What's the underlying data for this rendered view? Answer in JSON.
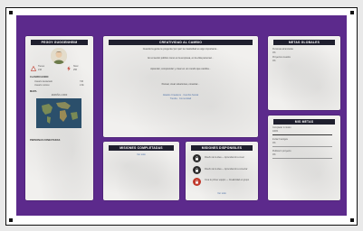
{
  "profile": {
    "title": "PEGGY GUGGENHEIM",
    "stat_left_label": "Tienes",
    "stat_left_value": "216",
    "stat_right_label": "Nivel",
    "stat_right_value": "256",
    "section_classification": "CLASIFICACION",
    "class_rows": [
      {
        "label": "Usuario destacado",
        "value": "746"
      },
      {
        "label": "Usuario curioso",
        "value": "2.9k"
      }
    ],
    "section_map": "MAPA",
    "map_label": "ESPAÑA 1.0000",
    "connected_label": "PERSONAS CONECTADAS"
  },
  "center": {
    "title": "CREATIVIDAD AL CAMBIO",
    "paragraphs": [
      "Cuando la gente te pregunta 'por qué' la creatividad es algo importante...",
      "En el sector público como en la empresa, en la vida personal...",
      "Aprender, comprender y crear en un mundo que cambia...",
      "Pensar, crear soluciones, conectar..."
    ],
    "links": [
      "Aliados Creativos · Cambio Social",
      "Tienda · Comunidad"
    ]
  },
  "left_bottom": {
    "title": "MISIONES COMPLETADAS",
    "link": "Ver todo"
  },
  "right_bottom": {
    "title": "MISIONES DISPONIBLES",
    "items": [
      "Diseño de la idea — Aprendiendo a crear",
      "Diseño de la idea — Aprendiendo a conectar",
      "Crea tu primer equipo — Creatividad en grupo"
    ],
    "link": "Ver todo"
  },
  "metas": {
    "title": "METAS GLOBALES",
    "rows": [
      {
        "label": "Personas alcanzadas",
        "value": "0%"
      },
      {
        "label": "Proyectos creados",
        "value": "0%"
      }
    ]
  },
  "mis_metas": {
    "title": "MIS METAS",
    "rows": [
      {
        "label": "Completar 1 misión",
        "value": "100%"
      },
      {
        "label": "Invitar 3 amigos",
        "value": "0%"
      },
      {
        "label": "Publicar 1 proyecto",
        "value": "0%"
      }
    ]
  },
  "colors": {
    "background_purple": "#5c2a8c",
    "header_dark": "#1f1f2e",
    "lock_dark": "#2a2a2a",
    "lock_red": "#c0392b"
  }
}
